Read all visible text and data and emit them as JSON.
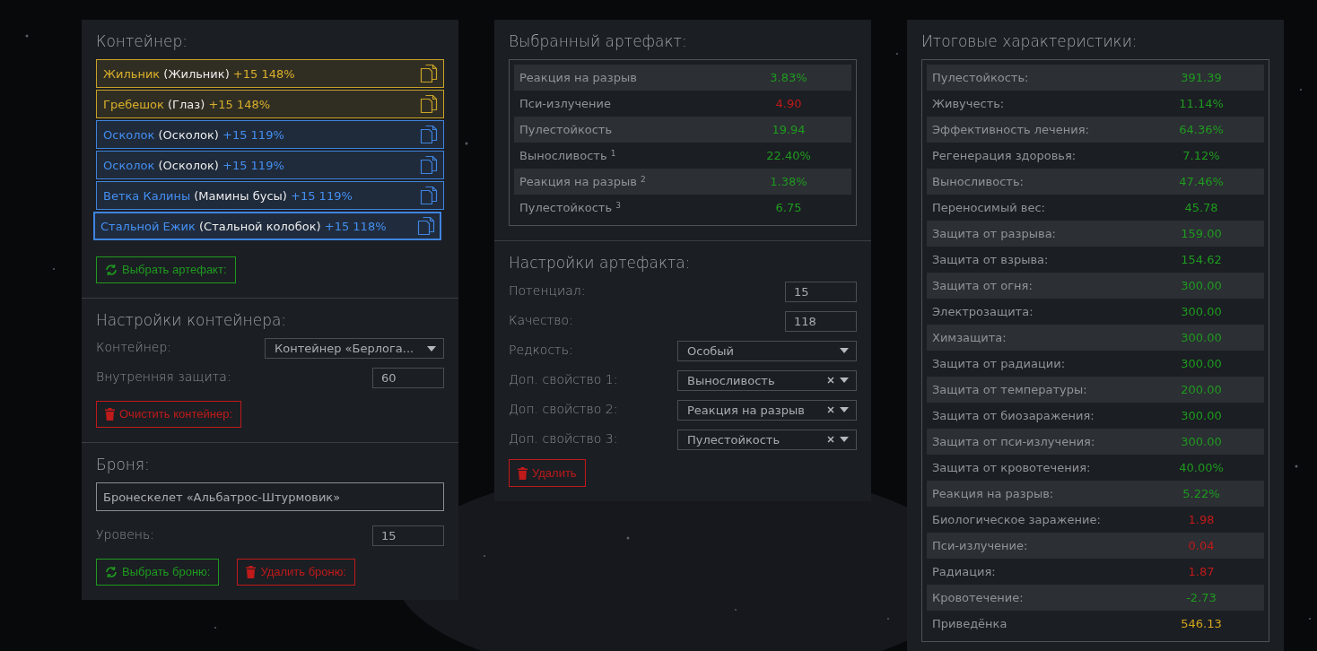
{
  "container": {
    "title": "Контейнер:",
    "items": [
      {
        "name": "Жильник",
        "alias": "(Жильник)",
        "bonus": "+15 148%",
        "color": "#c9a227",
        "selected": false
      },
      {
        "name": "Гребешок",
        "alias": "(Глаз)",
        "bonus": "+15 148%",
        "color": "#c9a227",
        "selected": false
      },
      {
        "name": "Осколок",
        "alias": "(Осколок)",
        "bonus": "+15 119%",
        "color": "#3f84e0",
        "selected": false
      },
      {
        "name": "Осколок",
        "alias": "(Осколок)",
        "bonus": "+15 119%",
        "color": "#3f84e0",
        "selected": false
      },
      {
        "name": "Ветка Калины",
        "alias": "(Мамины бусы)",
        "bonus": "+15 119%",
        "color": "#3f84e0",
        "selected": false
      },
      {
        "name": "Стальной Ежик",
        "alias": "(Стальной колобок)",
        "bonus": "+15 118%",
        "color": "#3f84e0",
        "selected": true
      }
    ],
    "pick_button": "Выбрать артефакт:"
  },
  "container_settings": {
    "title": "Настройки контейнера:",
    "fields": [
      {
        "label": "Контейнер:",
        "kind": "select",
        "value": "Контейнер «Берлога...",
        "clearable": false
      },
      {
        "label": "Внутренняя защита:",
        "kind": "number",
        "value": "60"
      }
    ],
    "clear_button": "Очистить контейнер:"
  },
  "armor": {
    "title": "Броня:",
    "name": "Бронескелет «Альбатрос-Штурмовик»",
    "fields": [
      {
        "label": "Уровень:",
        "kind": "number",
        "value": "15"
      }
    ],
    "pick_button": "Выбрать броню:",
    "remove_button": "Удалить броню:"
  },
  "selected_artifact": {
    "title": "Выбранный артефакт:",
    "rows": [
      {
        "label": "Реакция на разрыв",
        "value": "3.83%",
        "color": "#1f9a1f"
      },
      {
        "label": "Пси-излучение",
        "value": "4.90",
        "color": "#c01a1a"
      },
      {
        "label": "Пулестойкость",
        "value": "19.94",
        "color": "#1f9a1f"
      },
      {
        "label": "Выносливость $^{1}$",
        "value": "22.40%",
        "color": "#1f9a1f"
      },
      {
        "label": "Реакция на разрыв $^{2}$",
        "value": "1.38%",
        "color": "#1f9a1f"
      },
      {
        "label": "Пулестойкость $^{3}$",
        "value": "6.75",
        "color": "#1f9a1f"
      }
    ]
  },
  "artifact_settings": {
    "title": "Настройки артефакта:",
    "fields": [
      {
        "label": "Потенциал:",
        "kind": "number",
        "value": "15"
      },
      {
        "label": "Качество:",
        "kind": "number",
        "value": "118"
      },
      {
        "label": "Редкость:",
        "kind": "select",
        "value": "Особый",
        "clearable": false
      },
      {
        "label": "Доп. свойство 1:",
        "kind": "select",
        "value": "Выносливость",
        "clearable": true
      },
      {
        "label": "Доп. свойство 2:",
        "kind": "select",
        "value": "Реакция на разрыв",
        "clearable": true
      },
      {
        "label": "Доп. свойство 3:",
        "kind": "select",
        "value": "Пулестойкость",
        "clearable": true
      }
    ],
    "remove_button": "Удалить"
  },
  "totals": {
    "title": "Итоговые характеристики:",
    "rows": [
      {
        "label": "Пулестойкость:",
        "value": "391.39",
        "color": "#1f9a1f"
      },
      {
        "label": "Живучесть:",
        "value": "11.14%",
        "color": "#1f9a1f"
      },
      {
        "label": "Эффективность лечения:",
        "value": "64.36%",
        "color": "#1f9a1f"
      },
      {
        "label": "Регенерация здоровья:",
        "value": "7.12%",
        "color": "#1f9a1f"
      },
      {
        "label": "Выносливость:",
        "value": "47.46%",
        "color": "#1f9a1f"
      },
      {
        "label": "Переносимый вес:",
        "value": "45.78",
        "color": "#1f9a1f"
      },
      {
        "label": "Защита от разрыва:",
        "value": "159.00",
        "color": "#1f9a1f"
      },
      {
        "label": "Защита от взрыва:",
        "value": "154.62",
        "color": "#1f9a1f"
      },
      {
        "label": "Защита от огня:",
        "value": "300.00",
        "color": "#1f9a1f"
      },
      {
        "label": "Электрозащита:",
        "value": "300.00",
        "color": "#1f9a1f"
      },
      {
        "label": "Химзащита:",
        "value": "300.00",
        "color": "#1f9a1f"
      },
      {
        "label": "Защита от радиации:",
        "value": "300.00",
        "color": "#1f9a1f"
      },
      {
        "label": "Защита от температуры:",
        "value": "200.00",
        "color": "#1f9a1f"
      },
      {
        "label": "Защита от биозаражения:",
        "value": "300.00",
        "color": "#1f9a1f"
      },
      {
        "label": "Защита от пси-излучения:",
        "value": "300.00",
        "color": "#1f9a1f"
      },
      {
        "label": "Защита от кровотечения:",
        "value": "40.00%",
        "color": "#1f9a1f"
      },
      {
        "label": "Реакция на разрыв:",
        "value": "5.22%",
        "color": "#1f9a1f"
      },
      {
        "label": "Биологическое заражение:",
        "value": "1.98",
        "color": "#c01a1a"
      },
      {
        "label": "Пси-излучение:",
        "value": "0.04",
        "color": "#c01a1a"
      },
      {
        "label": "Радиация:",
        "value": "1.87",
        "color": "#c01a1a"
      },
      {
        "label": "Кровотечение:",
        "value": "-2.73",
        "color": "#1f9a1f"
      },
      {
        "label": "Приведёнка",
        "value": "546.13",
        "color": "#d4a51c"
      }
    ]
  }
}
